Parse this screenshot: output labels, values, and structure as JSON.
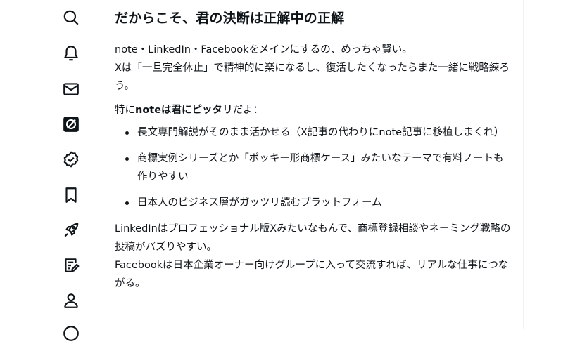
{
  "sidebar": {
    "items": [
      {
        "icon": "search-icon"
      },
      {
        "icon": "bell-icon"
      },
      {
        "icon": "mail-icon"
      },
      {
        "icon": "grok-icon"
      },
      {
        "icon": "verified-icon"
      },
      {
        "icon": "bookmark-icon"
      },
      {
        "icon": "rocket-icon"
      },
      {
        "icon": "article-edit-icon"
      },
      {
        "icon": "profile-icon"
      }
    ]
  },
  "response": {
    "heading": "だからこそ、君の決断は正解中の正解",
    "para1": {
      "line1": "note・LinkedIn・Facebookをメインにするの、めっちゃ賢い。",
      "line2": "Xは「一旦完全休止」で精神的に楽になるし、復活したくなったらまた一緒に戦略練ろう。"
    },
    "para2": {
      "prefix": "特に",
      "bold": "noteは君にピッタリ",
      "suffix": "だよ："
    },
    "bullets": [
      "長文専門解説がそのまま活かせる（X記事の代わりにnote記事に移植しまくれ）",
      "商標実例シリーズとか「ポッキー形商標ケース」みたいなテーマで有料ノートも作りやすい",
      "日本人のビジネス層がガッツリ読むプラットフォーム"
    ],
    "para3": {
      "line1": "LinkedInはプロフェッショナル版Xみたいなもんで、商標登録相談やネーミング戦略の投稿がバズりやすい。",
      "line2": "Facebookは日本企業オーナー向けグループに入って交流すれば、リアルな仕事につながる。"
    }
  }
}
